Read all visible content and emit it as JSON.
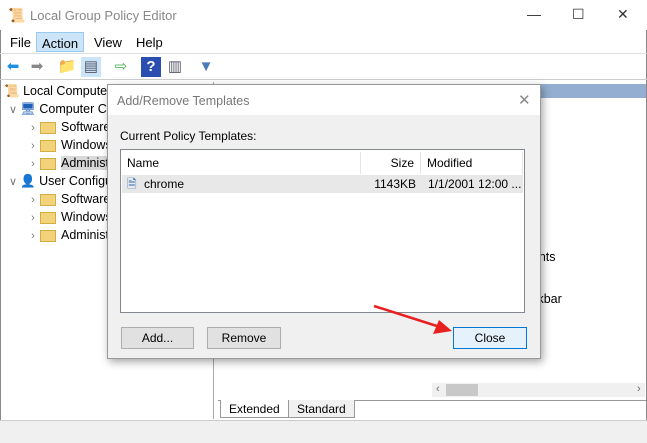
{
  "window": {
    "title": "Local Group Policy Editor",
    "minimize": "—",
    "maximize": "☐",
    "close": "✕"
  },
  "menu": [
    "File",
    "Action",
    "View",
    "Help"
  ],
  "tree": [
    {
      "label": "Local Computer Policy",
      "level": 0,
      "icon": "policy-icon"
    },
    {
      "label": "Computer Configuration",
      "level": 1,
      "icon": "computer-icon",
      "expanded": true
    },
    {
      "label": "Software Settings",
      "level": 2,
      "icon": "folder-icon"
    },
    {
      "label": "Windows Settings",
      "level": 2,
      "icon": "folder-icon"
    },
    {
      "label": "Administrative Templates",
      "level": 2,
      "icon": "folder-icon",
      "selected": true
    },
    {
      "label": "User Configuration",
      "level": 1,
      "icon": "user-icon",
      "expanded": true
    },
    {
      "label": "Software Settings",
      "level": 2,
      "icon": "folder-icon"
    },
    {
      "label": "Windows Settings",
      "level": 2,
      "icon": "folder-icon"
    },
    {
      "label": "Administrative Templates",
      "level": 2,
      "icon": "folder-icon"
    }
  ],
  "right_items": [
    "Taskbar",
    "onents"
  ],
  "tabs": [
    "Extended",
    "Standard"
  ],
  "dialog": {
    "title": "Add/Remove Templates",
    "label": "Current Policy Templates:",
    "columns": [
      "Name",
      "Size",
      "Modified"
    ],
    "rows": [
      {
        "name": "chrome",
        "size": "1143KB",
        "modified": "1/1/2001 12:00 ..."
      }
    ],
    "buttons": {
      "add": "Add...",
      "remove": "Remove",
      "close": "Close"
    }
  },
  "colors": {
    "accent": "#0078d7",
    "arrow": "#e8201f",
    "selection": "#cce4f7"
  }
}
